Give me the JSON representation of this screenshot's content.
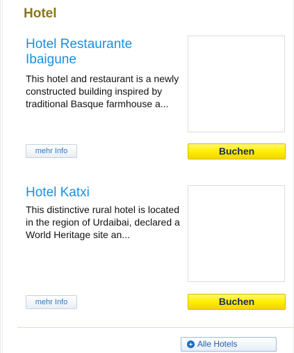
{
  "widget": {
    "title": "Hotel"
  },
  "hotels": [
    {
      "name": "Hotel Restaurante Ibaigune",
      "description": "This hotel and restaurant is a newly constructed building inspired by traditional Basque farmhouse a...",
      "more_label": "mehr Info",
      "book_label": "Buchen"
    },
    {
      "name": "Hotel Katxi",
      "description": "This distinctive rural hotel is located in the region of Urdaibai, declared a World Heritage site an...",
      "more_label": "mehr Info",
      "book_label": "Buchen"
    }
  ],
  "footer": {
    "all_hotels_label": "Alle Hotels",
    "all_hotels_icon": "plus-circle-icon"
  }
}
